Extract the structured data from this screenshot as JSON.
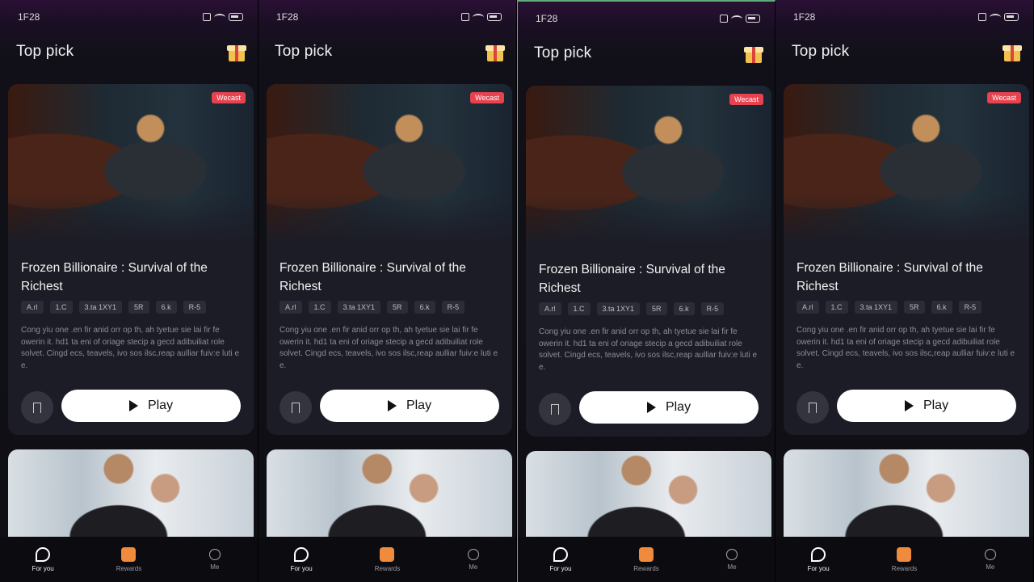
{
  "status": {
    "time": "1F28"
  },
  "header": {
    "title": "Top pick"
  },
  "card": {
    "badge": "Wecast",
    "title": "Frozen Billionaire : Survival of the Richest",
    "tags": [
      "A.rl",
      "1.C",
      "3.ta 1XY1",
      "5R",
      "6.k",
      "R-5"
    ],
    "description": "Cong yiu one .en fir anid orr op th, ah tyetue sie lai fir fe owerin it. hd1 ta eni of oriage stecip a gecd adibuiliat role solvet. Cingd ecs, teavels, ivo sos ilsc,reap aulliar fuiv:e luti e e.",
    "play_label": "Play"
  },
  "tabs": [
    {
      "label": "For you"
    },
    {
      "label": "Rewards"
    },
    {
      "label": "Me"
    }
  ],
  "colors": {
    "accent": "#e8424f",
    "card": "#1c1c26"
  }
}
